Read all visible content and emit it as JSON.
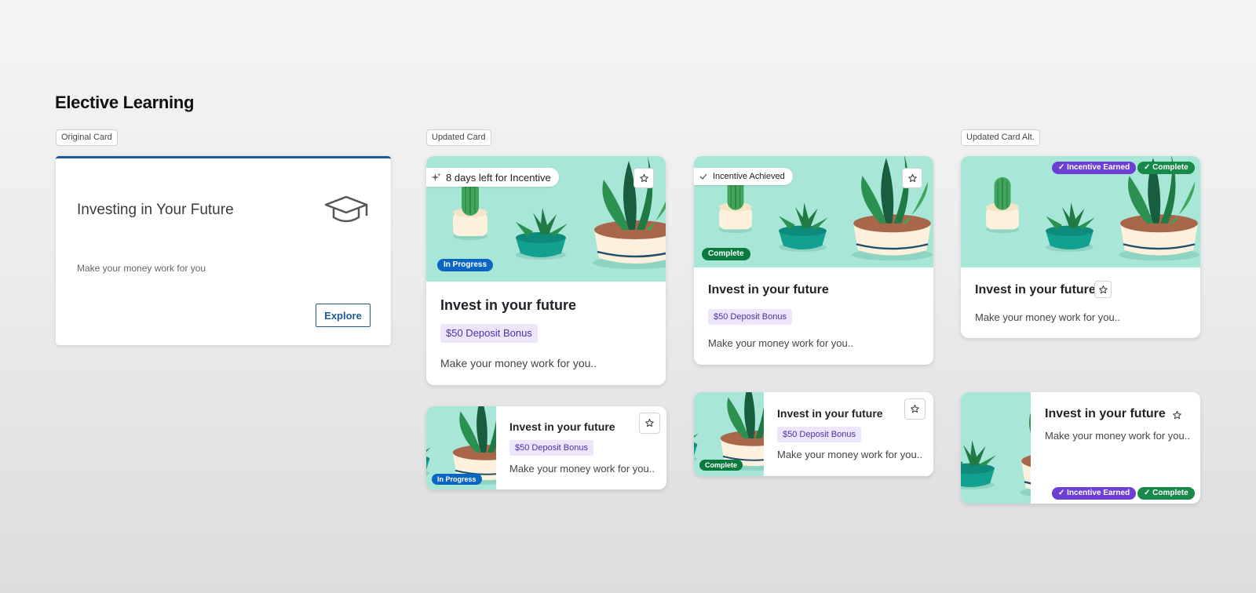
{
  "page": {
    "title": "Elective Learning"
  },
  "labels": {
    "original": "Original Card",
    "updated": "Updated Card",
    "updated_alt": "Updated Card Alt."
  },
  "original_card": {
    "title": "Investing in Your Future",
    "description": "Make your money work for you",
    "button": "Explore",
    "icon": "graduation-cap-icon",
    "accent": "#1e5a96"
  },
  "cards": {
    "updated_large": {
      "incentive": "8 days left for Incentive",
      "status": "In Progress",
      "title": "Invest in your future",
      "bonus": "$50 Deposit Bonus",
      "description": "Make your money work for you.."
    },
    "updated_small": {
      "status": "In Progress",
      "title": "Invest in your future",
      "bonus": "$50 Deposit Bonus",
      "description": "Make your money work for you.."
    },
    "achieved_large": {
      "incentive": "Incentive Achieved",
      "status": "Complete",
      "title": "Invest in your future",
      "bonus": "$50 Deposit Bonus",
      "description": "Make your money work for you.."
    },
    "achieved_small": {
      "status": "Complete",
      "title": "Invest in your future",
      "bonus": "$50 Deposit Bonus",
      "description": "Make your money work for you.."
    },
    "alt_large": {
      "earned": "Incentive Earned",
      "status": "Complete",
      "title": "Invest in your future",
      "description": "Make your money work for you.."
    },
    "alt_small": {
      "earned": "Incentive Earned",
      "status": "Complete",
      "title": "Invest in your future",
      "description": "Make your money work for you.."
    }
  },
  "colors": {
    "hero_bg": "#a8e6d8",
    "in_progress": "#0a66c2",
    "complete": "#0b7a3e",
    "incentive_earned": "#6b3fd4",
    "bonus_bg": "#ede6fb"
  }
}
